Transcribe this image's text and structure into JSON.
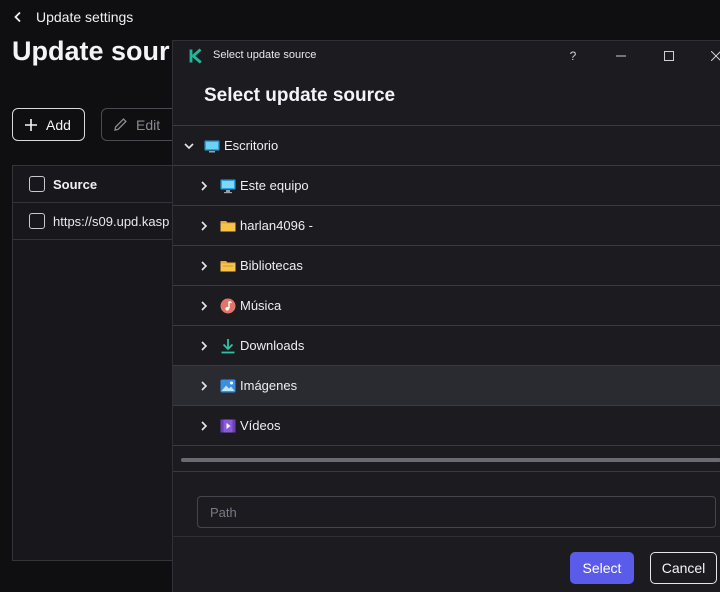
{
  "app": {
    "back_label": "Update settings",
    "page_title": "Update sour",
    "add_label": "Add",
    "edit_label": "Edit",
    "table": {
      "header": "Source",
      "rows": [
        "https://s09.upd.kasp"
      ]
    }
  },
  "dialog": {
    "window_title": "Select update source",
    "help_glyph": "?",
    "heading": "Select update source",
    "tree": [
      {
        "label": "Escritorio",
        "icon": "desktop-icon",
        "level": 0,
        "expanded": true
      },
      {
        "label": "Este equipo",
        "icon": "computer-icon",
        "level": 1
      },
      {
        "label": "harlan4096 -",
        "icon": "user-folder-icon",
        "level": 1
      },
      {
        "label": "Bibliotecas",
        "icon": "libraries-icon",
        "level": 1
      },
      {
        "label": "Música",
        "icon": "music-icon",
        "level": 1
      },
      {
        "label": "Downloads",
        "icon": "download-icon",
        "level": 1
      },
      {
        "label": "Imágenes",
        "icon": "pictures-icon",
        "level": 1,
        "selected": true
      },
      {
        "label": "Vídeos",
        "icon": "videos-icon",
        "level": 1
      }
    ],
    "path_placeholder": "Path",
    "path_value": "",
    "select_label": "Select",
    "cancel_label": "Cancel"
  },
  "colors": {
    "accent": "#5b5bea",
    "brand": "#1fb89c",
    "background": "#0f0f12",
    "dialog_background": "#1c1c20"
  }
}
